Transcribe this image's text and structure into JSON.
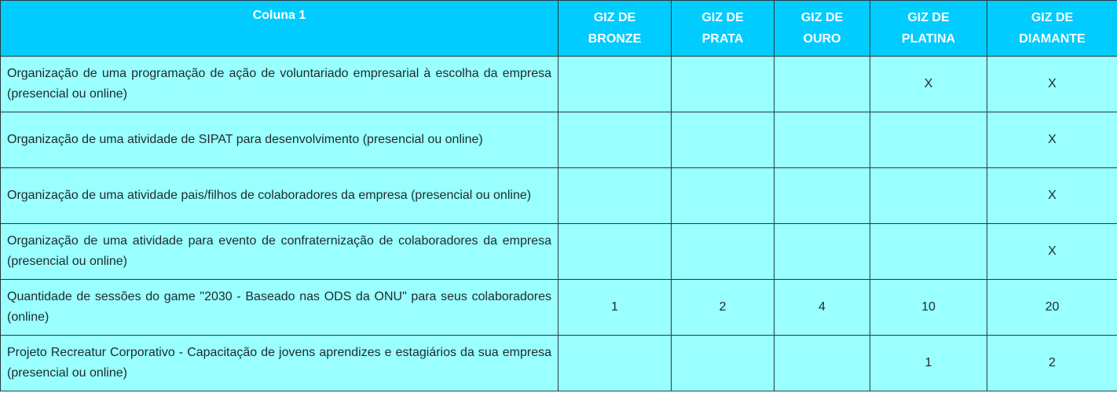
{
  "table": {
    "headers": [
      "Coluna 1",
      "GIZ DE\nBRONZE",
      "GIZ DE\nPRATA",
      "GIZ DE\nOURO",
      "GIZ DE\nPLATINA",
      "GIZ DE\nDIAMANTE"
    ],
    "rows": [
      {
        "description": "Organização de uma programação de ação de voluntariado empresarial à escolha da empresa (presencial ou online)",
        "values": [
          "",
          "",
          "",
          "X",
          "X"
        ]
      },
      {
        "description": "Organização de uma atividade de SIPAT para desenvolvimento (presencial ou online)",
        "values": [
          "",
          "",
          "",
          "",
          "X"
        ]
      },
      {
        "description": "Organização de uma atividade pais/filhos de colaboradores da empresa (presencial ou online)",
        "values": [
          "",
          "",
          "",
          "",
          "X"
        ]
      },
      {
        "description": "Organização de uma atividade para evento de confraternização de colaboradores da empresa (presencial ou online)",
        "values": [
          "",
          "",
          "",
          "",
          "X"
        ]
      },
      {
        "description": "Quantidade de sessões do game \"2030 - Baseado nas ODS da ONU\" para seus colaboradores (online)",
        "values": [
          "1",
          "2",
          "4",
          "10",
          "20"
        ]
      },
      {
        "description": "Projeto Recreatur Corporativo - Capacitação de jovens aprendizes e estagiários da sua empresa (presencial ou online)",
        "values": [
          "",
          "",
          "",
          "1",
          "2"
        ]
      }
    ]
  },
  "colors": {
    "header_bg": "#00ccff",
    "body_bg": "#99ffff",
    "header_text": "#ffffff",
    "border": "#2b3a3d"
  }
}
